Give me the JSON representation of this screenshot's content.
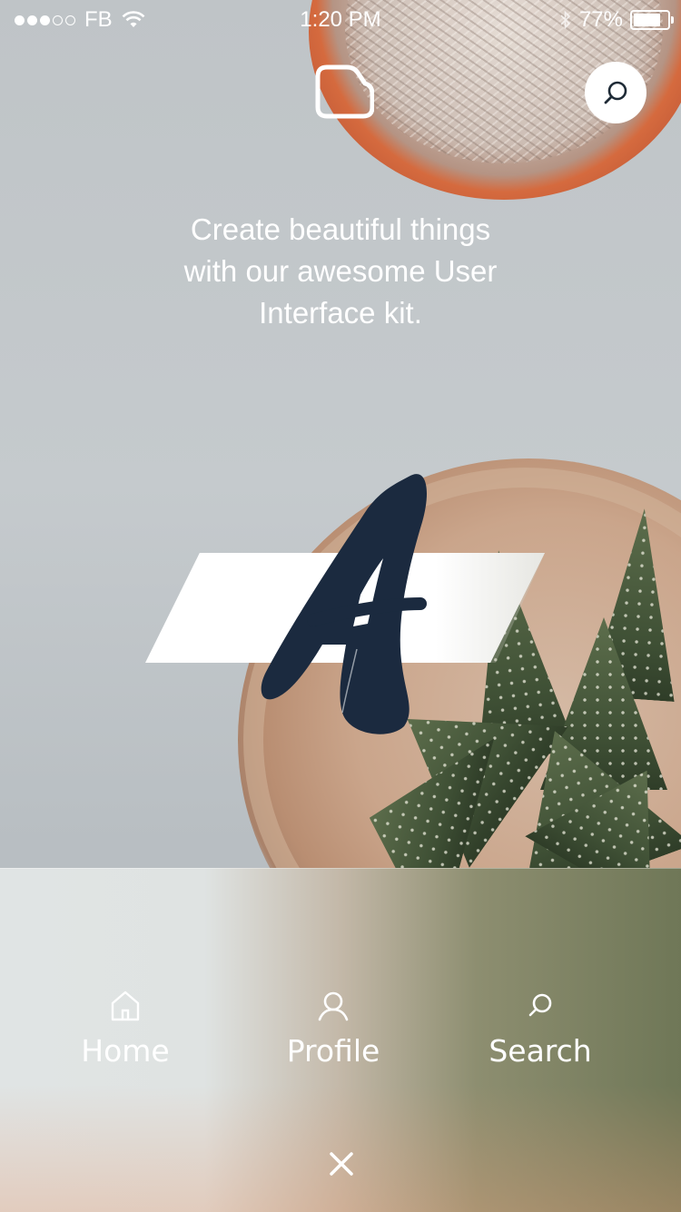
{
  "status_bar": {
    "carrier": "FB",
    "time": "1:20 PM",
    "battery_percent": "77%",
    "battery_level": 0.77,
    "signal_filled": 3,
    "signal_total": 5
  },
  "header": {
    "logo_icon": "sticky-note-icon",
    "search_icon": "search-icon"
  },
  "tagline": {
    "line1": "Create beautiful things",
    "line2": "with our awesome User",
    "line3": "Interface kit."
  },
  "brand": {
    "letter_mark": "A"
  },
  "nav": {
    "items": [
      {
        "label": "Home",
        "icon": "home-icon"
      },
      {
        "label": "Profile",
        "icon": "user-icon"
      },
      {
        "label": "Search",
        "icon": "search-icon"
      }
    ],
    "close_icon": "close-icon"
  },
  "colors": {
    "text": "#ffffff",
    "letter": "#1b2a3f",
    "pot_orange": "#d56a3e",
    "leaf_green": "#4d5e3f"
  }
}
